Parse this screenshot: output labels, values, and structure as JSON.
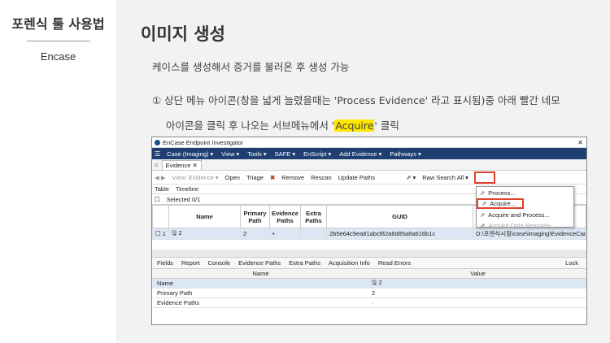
{
  "sidebar": {
    "title": "포렌식 툴 사용법",
    "subtitle": "Encase"
  },
  "slide": {
    "heading": "이미지 생성",
    "line1": "케이스를 생성해서 증거를 불러온 후 생성 가능",
    "line2": "① 상단 메뉴 아이콘(창을 넓게 늘렸을때는 'Process Evidence' 라고 표시됨)중 아래 빨간 네모",
    "line3_pre": "아이콘을 클릭 후 나오는 서브메뉴에서 '",
    "line3_hl": "Acquire",
    "line3_post": "' 클릭"
  },
  "encase": {
    "window_title": "EnCase Endpoint Investigator",
    "close": "✕",
    "menu": [
      "Case (Imaging) ▾",
      "View ▾",
      "Tools ▾",
      "SAFE ▾",
      "EnScript ▾",
      "Add Evidence ▾",
      "Pathways ▾"
    ],
    "tab": "Evidence ✕",
    "toolbar": {
      "view": "View: Evidence ▾",
      "open": "Open",
      "triage": "Triage",
      "remove": "Remove",
      "rescan": "Rescan",
      "update": "Update Paths",
      "raw_search": "Raw Search All ▾"
    },
    "viewbar": {
      "table": "Table",
      "timeline": "Timeline"
    },
    "selected": "Selected 0/1",
    "columns": [
      "",
      "Name",
      "Primary Path",
      "Evidence Paths",
      "Extra Paths",
      "GUID",
      ""
    ],
    "row": [
      "☐ 1",
      "🖫 2",
      "2",
      "•",
      "",
      "2b5e64c9ea81abcf82a6d85a8a616b1c",
      "D:\\포렌식시험\\case\\imaging\\EvidenceCache"
    ],
    "dropdown": [
      {
        "label": "Process...",
        "disabled": false
      },
      {
        "label": "Acquire...",
        "disabled": false
      },
      {
        "label": "Acquire and Process...",
        "disabled": false
      },
      {
        "label": "Acquire Data Remotely...",
        "disabled": true
      }
    ],
    "bottom_tabs": [
      "Fields",
      "Report",
      "Console",
      "Evidence Paths",
      "Extra Paths",
      "Acquisition Info",
      "Read Errors",
      "Lock"
    ],
    "fields_head": {
      "name": "Name",
      "value": "Value"
    },
    "fields": [
      {
        "name": "Name",
        "value": "🖫 2"
      },
      {
        "name": "Primary Path",
        "value": "2"
      },
      {
        "name": "Evidence Paths",
        "value": "·"
      }
    ]
  }
}
